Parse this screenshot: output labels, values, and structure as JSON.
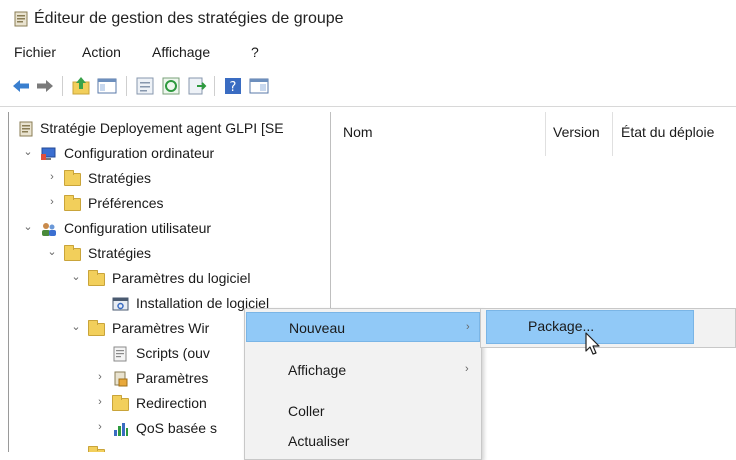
{
  "window": {
    "title": "Éditeur de gestion des stratégies de groupe",
    "icon": "gpo-editor-icon"
  },
  "menubar": {
    "items": [
      "Fichier",
      "Action",
      "Affichage",
      "?"
    ]
  },
  "toolbar": {
    "buttons": [
      "back-icon",
      "forward-icon",
      "up-folder-icon",
      "show-hide-tree-icon",
      "properties-icon",
      "refresh-icon",
      "export-list-icon",
      "help-icon",
      "view-icon"
    ]
  },
  "tree": {
    "items": [
      {
        "label": "Stratégie Deployement agent GLPI [SE",
        "icon": "policy-icon",
        "expander": ""
      },
      {
        "label": "Configuration ordinateur",
        "icon": "computer-config-icon",
        "expander": "expanded"
      },
      {
        "label": "Stratégies",
        "icon": "folder-icon",
        "expander": "collapsed"
      },
      {
        "label": "Préférences",
        "icon": "folder-icon",
        "expander": "collapsed"
      },
      {
        "label": "Configuration utilisateur",
        "icon": "user-config-icon",
        "expander": "expanded"
      },
      {
        "label": "Stratégies",
        "icon": "folder-icon",
        "expander": "expanded"
      },
      {
        "label": "Paramètres du logiciel",
        "icon": "folder-icon",
        "expander": "expanded"
      },
      {
        "label": "Installation de logiciel",
        "icon": "software-install-icon",
        "expander": ""
      },
      {
        "label": "Paramètres Wir",
        "icon": "folder-icon",
        "expander": "expanded"
      },
      {
        "label": "Scripts (ouv",
        "icon": "script-icon",
        "expander": ""
      },
      {
        "label": "Paramètres",
        "icon": "security-settings-icon",
        "expander": "collapsed"
      },
      {
        "label": "Redirection",
        "icon": "folder-redirect-icon",
        "expander": "collapsed"
      },
      {
        "label": "QoS basée s",
        "icon": "qos-chart-icon",
        "expander": "collapsed"
      }
    ]
  },
  "list": {
    "columns": [
      "Nom",
      "Version",
      "État du déploie"
    ]
  },
  "context_menu": {
    "items": [
      {
        "label": "Nouveau",
        "submenu": true,
        "highlighted": true
      },
      {
        "label": "Affichage",
        "submenu": true,
        "highlighted": false
      },
      {
        "label": "Coller",
        "submenu": false,
        "highlighted": false
      },
      {
        "label": "Actualiser",
        "submenu": false,
        "highlighted": false
      }
    ]
  },
  "submenu": {
    "items": [
      {
        "label": "Package...",
        "highlighted": true
      }
    ]
  },
  "colors": {
    "highlight": "#91c9f7",
    "menu_bg": "#f2f2f2",
    "folder": "#f2cf5b"
  }
}
